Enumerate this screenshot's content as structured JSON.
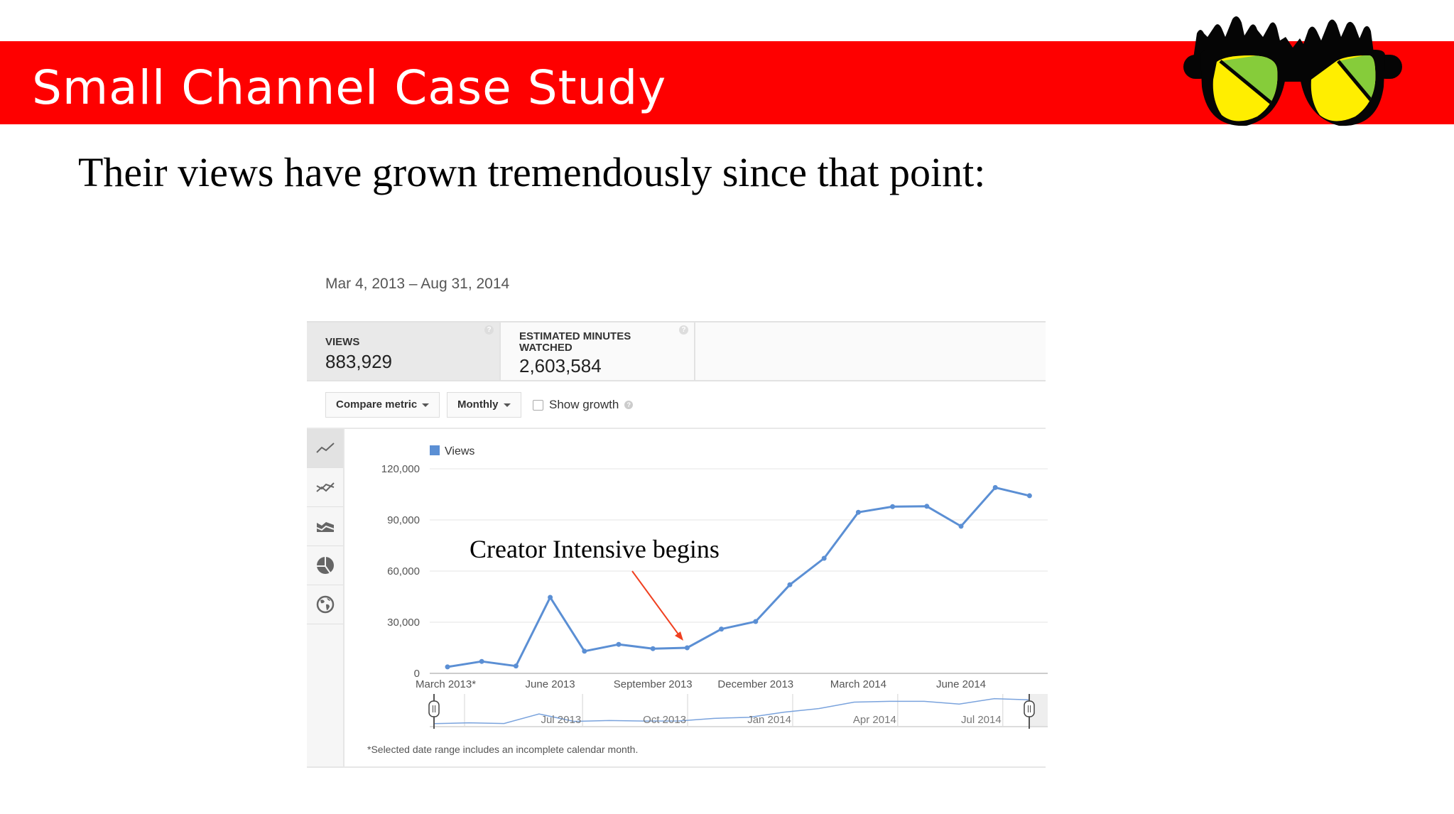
{
  "slide": {
    "title": "Small Channel Case Study",
    "subtitle": "Their views have grown tremendously since that point:",
    "logo": "glasses-logo-icon",
    "colors": {
      "band": "#fe0000",
      "lens_green": "#86cc3a",
      "lens_yellow": "#ffee00"
    }
  },
  "analytics": {
    "date_range": "Mar 4, 2013 – Aug 31, 2014",
    "metrics": [
      {
        "label_lines": [
          "VIEWS"
        ],
        "value": "883,929",
        "selected": true
      },
      {
        "label_lines": [
          "ESTIMATED MINUTES",
          "WATCHED"
        ],
        "value": "2,603,584",
        "selected": false
      }
    ],
    "help_glyph": "?",
    "toolbar": {
      "compare_metric": "Compare metric",
      "interval": "Monthly",
      "show_growth": "Show growth",
      "show_growth_checked": false
    },
    "chart_types": [
      {
        "name": "line-chart-icon",
        "active": true
      },
      {
        "name": "multi-line-chart-icon",
        "active": false
      },
      {
        "name": "stacked-area-chart-icon",
        "active": false
      },
      {
        "name": "pie-chart-icon",
        "active": false
      },
      {
        "name": "globe-map-icon",
        "active": false
      }
    ],
    "footnote": "*Selected date range includes an incomplete calendar month."
  },
  "annotation": {
    "text": "Creator Intensive begins",
    "arrow_color": "#f04020",
    "points_to": "October 2013"
  },
  "chart_data": {
    "type": "line",
    "title": "",
    "xlabel": "",
    "ylabel": "",
    "legend": [
      "Views"
    ],
    "legend_position": "top-left",
    "series_color": "#5b8fd4",
    "x": [
      "Mar 2013",
      "Apr 2013",
      "May 2013",
      "Jun 2013",
      "Jul 2013",
      "Aug 2013",
      "Sep 2013",
      "Oct 2013",
      "Nov 2013",
      "Dec 2013",
      "Jan 2014",
      "Feb 2014",
      "Mar 2014",
      "Apr 2014",
      "May 2014",
      "Jun 2014",
      "Jul 2014",
      "Aug 2014"
    ],
    "series": [
      {
        "name": "Views",
        "values": [
          3800,
          7000,
          4300,
          44600,
          13000,
          17000,
          14500,
          15000,
          26000,
          30400,
          52000,
          67500,
          94500,
          97800,
          98000,
          86300,
          109000,
          104200
        ]
      }
    ],
    "ylim": [
      0,
      120000
    ],
    "yticks": [
      0,
      30000,
      60000,
      90000,
      120000
    ],
    "ytick_labels": [
      "0",
      "30,000",
      "60,000",
      "90,000",
      "120,000"
    ],
    "xtick_labels": [
      {
        "label": "March 2013*",
        "index": 0
      },
      {
        "label": "June 2013",
        "index": 3
      },
      {
        "label": "September 2013",
        "index": 6
      },
      {
        "label": "December 2013",
        "index": 9
      },
      {
        "label": "March 2014",
        "index": 12
      },
      {
        "label": "June 2014",
        "index": 15
      }
    ],
    "grid": true,
    "navigator": {
      "labels": [
        {
          "label": "Jul 2013",
          "index": 4
        },
        {
          "label": "Oct 2013",
          "index": 7
        },
        {
          "label": "Jan 2014",
          "index": 10
        },
        {
          "label": "Apr 2014",
          "index": 13
        },
        {
          "label": "Jul 2014",
          "index": 16
        }
      ],
      "selection_start_index": 0,
      "selection_end_index": 17
    }
  }
}
